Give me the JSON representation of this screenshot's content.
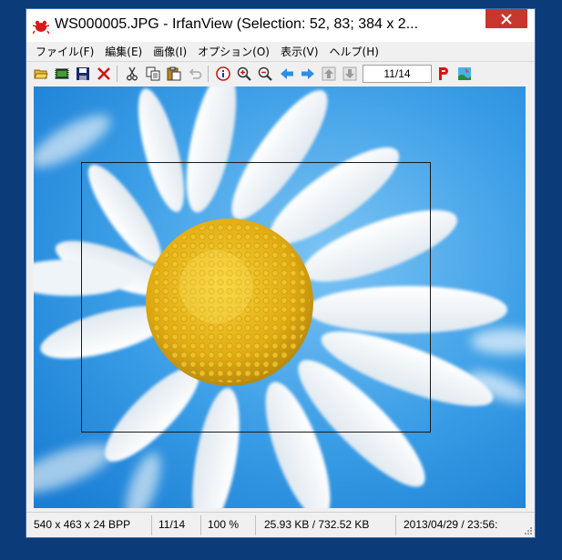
{
  "window": {
    "title": "WS000005.JPG - IrfanView (Selection: 52, 83; 384 x 2..."
  },
  "menu": {
    "items": [
      "ファイル(F)",
      "編集(E)",
      "画像(I)",
      "オプション(O)",
      "表示(V)",
      "ヘルプ(H)"
    ]
  },
  "toolbar": {
    "page_value": "11/14",
    "icons": [
      "open-folder-icon",
      "slideshow-icon",
      "save-icon",
      "delete-icon",
      "cut-icon",
      "copy-icon",
      "paste-icon",
      "undo-icon",
      "info-icon",
      "zoom-in-icon",
      "zoom-out-icon",
      "previous-arrow-icon",
      "next-arrow-icon",
      "first-page-icon",
      "last-page-icon",
      "print-icon",
      "paint-icon"
    ]
  },
  "colors": {
    "close_button": "#c7372f",
    "sky_blue": "#2a8fe0",
    "flower_center": "#e9b919",
    "desktop": "#0b3b78"
  },
  "statusbar": {
    "dimensions": "540 x 463 x 24 BPP",
    "index": "11/14",
    "zoom": "100 %",
    "filesize": "25.93 KB / 732.52 KB",
    "datetime": "2013/04/29 / 23:56:"
  }
}
